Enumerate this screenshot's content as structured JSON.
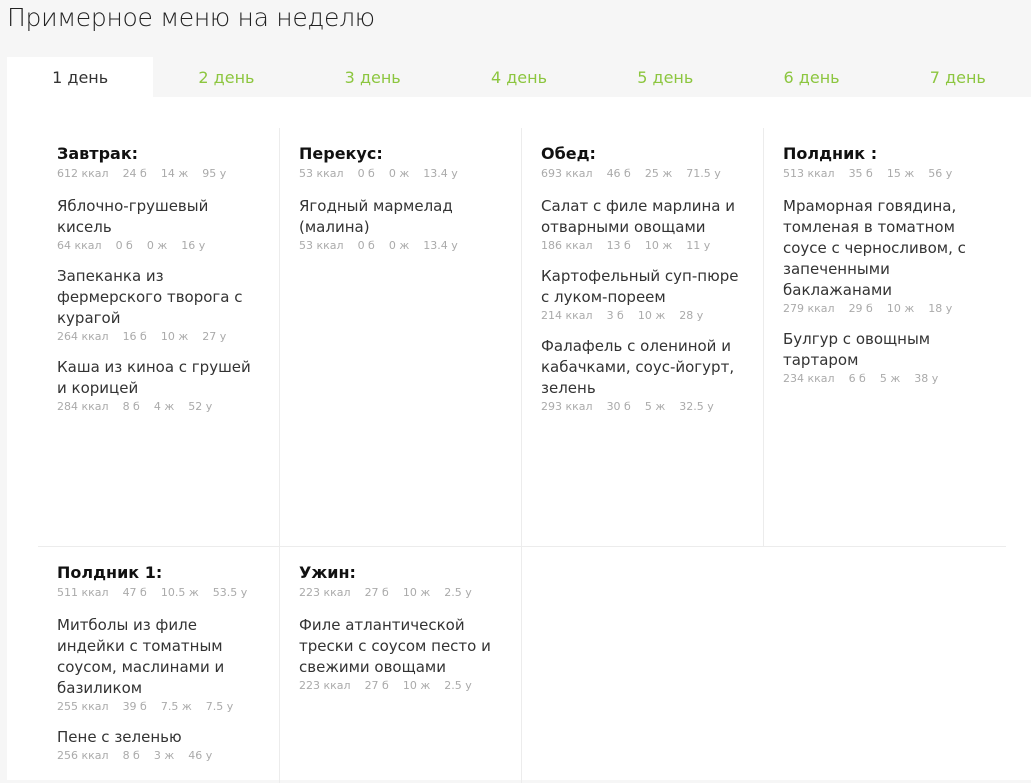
{
  "page": {
    "title": "Примерное меню на неделю"
  },
  "tabs": [
    {
      "label": "1 день",
      "active": true
    },
    {
      "label": "2 день",
      "active": false
    },
    {
      "label": "3 день",
      "active": false
    },
    {
      "label": "4 день",
      "active": false
    },
    {
      "label": "5 день",
      "active": false
    },
    {
      "label": "6 день",
      "active": false
    },
    {
      "label": "7 день",
      "active": false
    }
  ],
  "meals": [
    {
      "title": "Завтрак:",
      "totals": {
        "kcal": "612 ккал",
        "protein": "24 б",
        "fat": "14 ж",
        "carbs": "95 у"
      },
      "dishes": [
        {
          "name": "Яблочно-грушевый кисель",
          "kcal": "64 ккал",
          "protein": "0 б",
          "fat": "0 ж",
          "carbs": "16 у"
        },
        {
          "name": "Запеканка из фермерского творога с курагой",
          "kcal": "264 ккал",
          "protein": "16 б",
          "fat": "10 ж",
          "carbs": "27 у"
        },
        {
          "name": "Каша из киноа с грушей и корицей",
          "kcal": "284 ккал",
          "protein": "8 б",
          "fat": "4 ж",
          "carbs": "52 у"
        }
      ]
    },
    {
      "title": "Перекус:",
      "totals": {
        "kcal": "53 ккал",
        "protein": "0 б",
        "fat": "0 ж",
        "carbs": "13.4 у"
      },
      "dishes": [
        {
          "name": "Ягодный мармелад (малина)",
          "kcal": "53 ккал",
          "protein": "0 б",
          "fat": "0 ж",
          "carbs": "13.4 у"
        }
      ]
    },
    {
      "title": "Обед:",
      "totals": {
        "kcal": "693 ккал",
        "protein": "46 б",
        "fat": "25 ж",
        "carbs": "71.5 у"
      },
      "dishes": [
        {
          "name": "Салат с филе марлина и отварными овощами",
          "kcal": "186 ккал",
          "protein": "13 б",
          "fat": "10 ж",
          "carbs": "11 у"
        },
        {
          "name": "Картофельный суп-пюре с луком-пореем",
          "kcal": "214 ккал",
          "protein": "3 б",
          "fat": "10 ж",
          "carbs": "28 у"
        },
        {
          "name": "Фалафель с олениной и кабачками, соус-йогурт, зелень",
          "kcal": "293 ккал",
          "protein": "30 б",
          "fat": "5 ж",
          "carbs": "32.5 у"
        }
      ]
    },
    {
      "title": "Полдник :",
      "totals": {
        "kcal": "513 ккал",
        "protein": "35 б",
        "fat": "15 ж",
        "carbs": "56 у"
      },
      "dishes": [
        {
          "name": "Мраморная говядина, томленая в томатном соусе с черносливом, с запеченными баклажанами",
          "kcal": "279 ккал",
          "protein": "29 б",
          "fat": "10 ж",
          "carbs": "18 у"
        },
        {
          "name": "Булгур с овощным тартаром",
          "kcal": "234 ккал",
          "protein": "6 б",
          "fat": "5 ж",
          "carbs": "38 у"
        }
      ]
    },
    {
      "title": "Полдник 1:",
      "totals": {
        "kcal": "511 ккал",
        "protein": "47 б",
        "fat": "10.5 ж",
        "carbs": "53.5 у"
      },
      "dishes": [
        {
          "name": "Митболы из филе индейки с томатным соусом, маслинами и базиликом",
          "kcal": "255 ккал",
          "protein": "39 б",
          "fat": "7.5 ж",
          "carbs": "7.5 у"
        },
        {
          "name": "Пене с зеленью",
          "kcal": "256 ккал",
          "protein": "8 б",
          "fat": "3 ж",
          "carbs": "46 у"
        }
      ]
    },
    {
      "title": "Ужин:",
      "totals": {
        "kcal": "223 ккал",
        "protein": "27 б",
        "fat": "10 ж",
        "carbs": "2.5 у"
      },
      "dishes": [
        {
          "name": "Филе атлантической трески с соусом песто и свежими овощами",
          "kcal": "223 ккал",
          "protein": "27 б",
          "fat": "10 ж",
          "carbs": "2.5 у"
        }
      ]
    }
  ],
  "colors": {
    "accent": "#8cc63f",
    "muted": "#aaaaaa",
    "divider": "#ececec"
  }
}
